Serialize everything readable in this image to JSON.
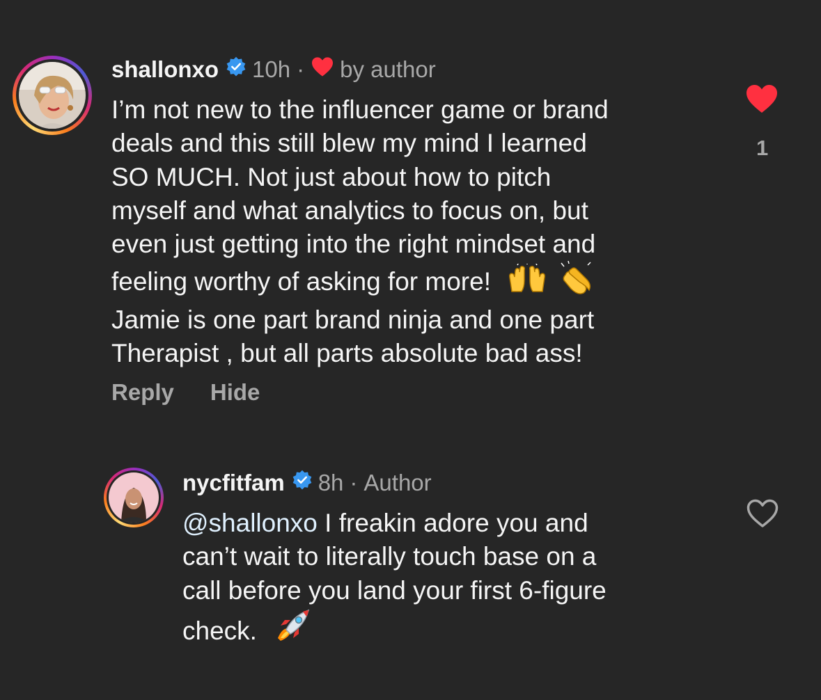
{
  "comments": [
    {
      "username": "shallonxo",
      "verified": true,
      "time": "10h",
      "separator": "·",
      "liked_by_author_label": "by author",
      "text_lines": [
        "I’m not new to the influencer game or brand",
        "deals and this still blew my mind I learned",
        "SO MUCH. Not just about how to pitch",
        "myself and what analytics to focus on, but",
        "even just getting into the right mindset and",
        "feeling worthy of asking for more!",
        "Jamie is one part brand ninja and one part",
        "Therapist , but all parts absolute bad ass!"
      ],
      "emojis_line6": [
        "raising-hands-emoji",
        "clapping-hands-emoji"
      ],
      "reply_label": "Reply",
      "hide_label": "Hide",
      "liked": true,
      "like_count": "1"
    },
    {
      "username": "nycfitfam",
      "verified": true,
      "time": "8h",
      "separator": "·",
      "author_label": "Author",
      "mention": "@shallonxo",
      "text_line1_rest": " I freakin adore you and",
      "text_lines": [
        "can’t wait to literally touch base on a",
        "call before you land your first 6-figure",
        "check."
      ],
      "emoji_end": "rocket-emoji",
      "liked": false
    }
  ],
  "colors": {
    "background": "#262626",
    "text": "#f5f5f5",
    "secondary": "#a8a8a8",
    "heart": "#ff3040",
    "verified": "#3897f0",
    "mention": "#e0f1ff"
  }
}
